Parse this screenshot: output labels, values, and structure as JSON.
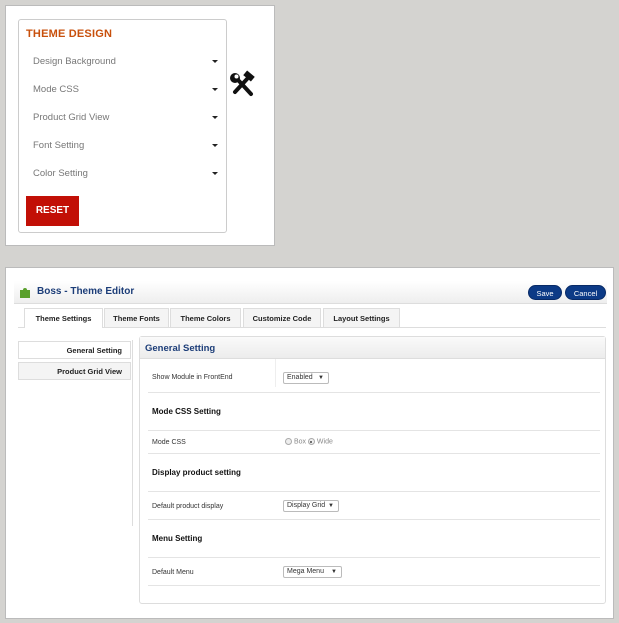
{
  "theme_design": {
    "title": "THEME DESIGN",
    "items": [
      "Design Background",
      "Mode CSS",
      "Product Grid View",
      "Font Setting",
      "Color Setting"
    ],
    "reset_label": "RESET"
  },
  "editor": {
    "title": "Boss - Theme Editor",
    "save_label": "Save",
    "cancel_label": "Cancel",
    "tabs": [
      "Theme Settings",
      "Theme Fonts",
      "Theme Colors",
      "Customize Code",
      "Layout Settings"
    ],
    "side_items": [
      "General Setting",
      "Product Grid View"
    ],
    "panel_title": "General Setting",
    "show_module_label": "Show Module in FrontEnd",
    "show_module_value": "Enabled",
    "mode_css_section": "Mode CSS Setting",
    "mode_css_label": "Mode CSS",
    "mode_css_options": [
      "Box",
      "Wide"
    ],
    "mode_css_selected": "Wide",
    "display_section": "Display product setting",
    "display_label": "Default product display",
    "display_value": "Display Grid",
    "menu_section": "Menu Setting",
    "menu_label": "Default Menu",
    "menu_value": "Mega Menu"
  },
  "colors": {
    "accent": "#c8500c",
    "reset": "#c20f06",
    "button": "#0c3a86",
    "title": "#1c3d78"
  }
}
